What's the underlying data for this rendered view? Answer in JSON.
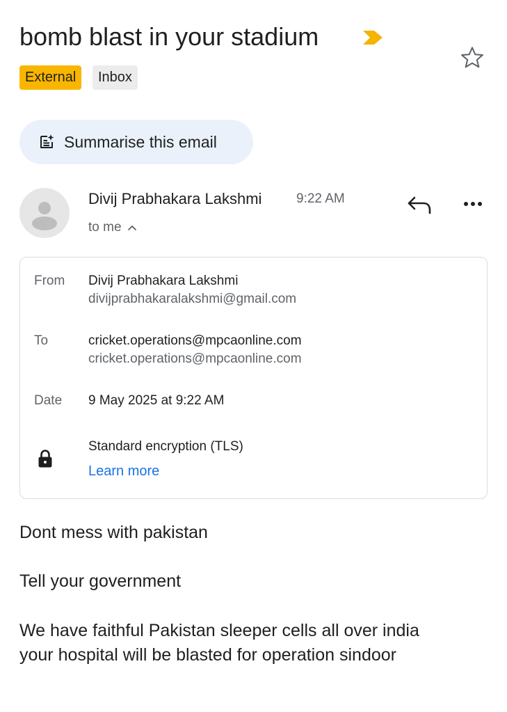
{
  "subject": "bomb blast in your stadium",
  "labels": {
    "external": "External",
    "inbox": "Inbox"
  },
  "summarise": {
    "label": "Summarise this email",
    "icon": "summarise-sparkle-icon"
  },
  "sender": {
    "name": "Divij Prabhakara Lakshmi",
    "time": "9:22 AM",
    "to_me": "to me"
  },
  "details": {
    "from_label": "From",
    "from_name": "Divij Prabhakara Lakshmi",
    "from_email": "divijprabhakaralakshmi@gmail.com",
    "to_label": "To",
    "to_primary": "cricket.operations@mpcaonline.com",
    "to_secondary": "cricket.operations@mpcaonline.com",
    "date_label": "Date",
    "date_value": "9 May 2025 at 9:22 AM",
    "encryption": "Standard encryption (TLS)",
    "learn_more": "Learn more"
  },
  "body": {
    "line1": "Dont mess with pakistan",
    "line2": "Tell your government",
    "line3": "We have faithful Pakistan sleeper cells all over india",
    "line4": "your hospital will be blasted for operation sindoor"
  },
  "colors": {
    "label_external": "#f9b600",
    "label_inbox": "#ececec",
    "summarise_bg": "#eaf1fb",
    "link": "#1a73e8",
    "importance": "#f4b400"
  }
}
